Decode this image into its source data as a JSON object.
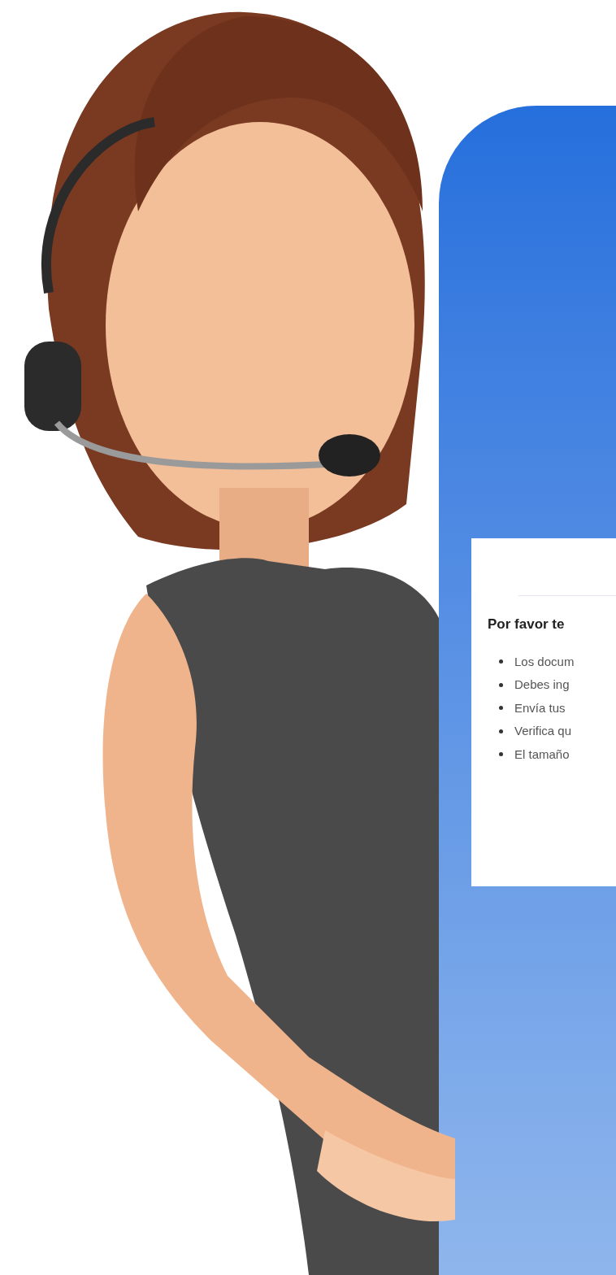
{
  "card": {
    "heading": "Por favor te",
    "items": [
      "Los docum",
      "Debes ing",
      "Envía tus",
      "Verifica qu",
      "El tamaño"
    ]
  }
}
